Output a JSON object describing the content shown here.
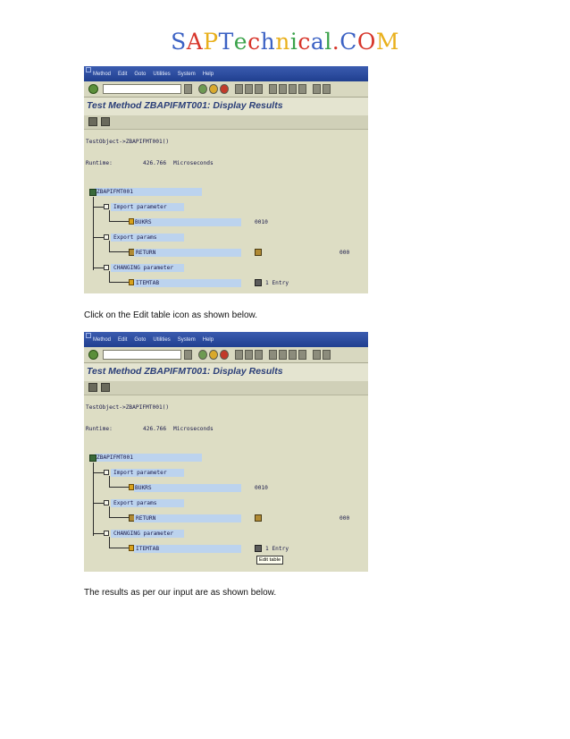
{
  "logo": {
    "letters": [
      {
        "ch": "S",
        "color": "#3c62c4"
      },
      {
        "ch": "A",
        "color": "#d7352a"
      },
      {
        "ch": "P",
        "color": "#e9b01c"
      },
      {
        "ch": "T",
        "color": "#3c62c4"
      },
      {
        "ch": "e",
        "color": "#3aa24a"
      },
      {
        "ch": "c",
        "color": "#d7352a"
      },
      {
        "ch": "h",
        "color": "#3c62c4"
      },
      {
        "ch": "n",
        "color": "#e9b01c"
      },
      {
        "ch": "i",
        "color": "#3aa24a"
      },
      {
        "ch": "c",
        "color": "#d7352a"
      },
      {
        "ch": "a",
        "color": "#3c62c4"
      },
      {
        "ch": "l",
        "color": "#3aa24a"
      },
      {
        "ch": ".",
        "color": "#d7352a"
      },
      {
        "ch": "C",
        "color": "#3c62c4"
      },
      {
        "ch": "O",
        "color": "#d7352a"
      },
      {
        "ch": "M",
        "color": "#e9b01c"
      }
    ]
  },
  "sap": {
    "menu": [
      "Method",
      "Edit",
      "Goto",
      "Utilities",
      "System",
      "Help"
    ],
    "title": "Test Method ZBAPIFMT001: Display Results",
    "test_object": "TestObject->ZBAPIFMT001()",
    "runtime_label": "Runtime:",
    "runtime_value": "426.766",
    "runtime_unit": "Microseconds",
    "root": "ZBAPIFMT001",
    "import_label": "Import parameter",
    "bukrs": "BUKRS",
    "bukrs_value": "0010",
    "export_label": "Export params",
    "return_label": "RETURN",
    "return_value": "000",
    "changing_label": "CHANGING parameter",
    "itemtab": "ITEMTAB",
    "itemtab_value": "1 Entry",
    "tooltip": "Edit table"
  },
  "captions": {
    "first": "Click on the Edit table icon as shown below.",
    "second": "The results as per our input are as shown below."
  }
}
